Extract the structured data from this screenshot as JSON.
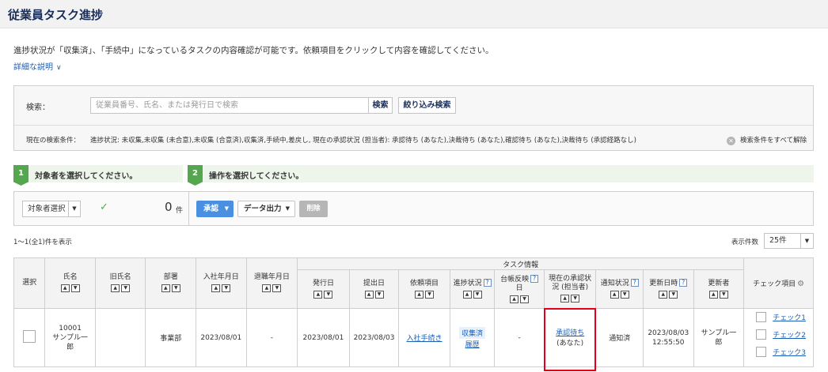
{
  "header": {
    "title": "従業員タスク進捗"
  },
  "intro": {
    "description": "進捗状況が「収集済」、「手続中」になっているタスクの内容確認が可能です。依頼項目をクリックして内容を確認してください。",
    "detail_link": "詳細な説明"
  },
  "search": {
    "label": "検索：",
    "placeholder": "従業員番号、氏名、または発行日で検索",
    "value": "",
    "search_button": "検索",
    "filter_button": "絞り込み検索",
    "current_label": "現在の検索条件：",
    "current_conditions": "進捗状況: 未収集,未収集 (未合意),未収集 (合意済),収集済,手続中,差戻し, 現在の承認状況 (担当者): 承認待ち (あなた),決裁待ち (あなた),確認待ち (あなた),決裁待ち (承認経路なし)",
    "clear_all": "検索条件をすべて解除"
  },
  "steps": [
    {
      "num": "1",
      "text": "対象者を選択してください。"
    },
    {
      "num": "2",
      "text": "操作を選択してください。"
    }
  ],
  "actions": {
    "target_select": "対象者選択",
    "selected_count": "0",
    "count_unit": "件",
    "approve": "承認",
    "export": "データ出力",
    "delete": "削除"
  },
  "listing": {
    "range": "1〜1(全1)件を表示",
    "per_page_label": "表示件数",
    "per_page_value": "25件"
  },
  "table": {
    "group_header": "タスク情報",
    "headers": {
      "select": "選択",
      "name": "氏名",
      "old_name": "旧氏名",
      "department": "部署",
      "hire_date": "入社年月日",
      "leave_date": "退職年月日",
      "issue_date": "発行日",
      "submit_date": "提出日",
      "request_item": "依頼項目",
      "progress": "進捗状況",
      "ledger_1": "台帳反映",
      "ledger_2": "日",
      "approval_1": "現在の承認状",
      "approval_2": "況 (担当者)",
      "notice": "通知状況",
      "updated_at": "更新日時",
      "updater": "更新者",
      "check_items": "チェック項目"
    },
    "rows": [
      {
        "emp_no": "10001",
        "name_1": "サンプル一",
        "name_2": "郎",
        "old_name": "",
        "department": "事業部",
        "hire_date": "2023/08/01",
        "leave_date": "-",
        "issue_date": "2023/08/01",
        "submit_date": "2023/08/03",
        "request_item": "入社手続き",
        "progress": "収集済",
        "history": "履歴",
        "ledger": "-",
        "approval_status": "承認待ち",
        "approval_actor": "(あなた)",
        "notice": "通知済",
        "updated_date": "2023/08/03",
        "updated_time": "12:55:50",
        "updater_1": "サンプル一",
        "updater_2": "郎",
        "checks": [
          "チェック1",
          "チェック2",
          "チェック3"
        ]
      }
    ]
  },
  "colors": {
    "accent": "#4a8fe0",
    "step": "#56a64f",
    "link": "#1b5fb5",
    "highlight": "#e4001b"
  }
}
